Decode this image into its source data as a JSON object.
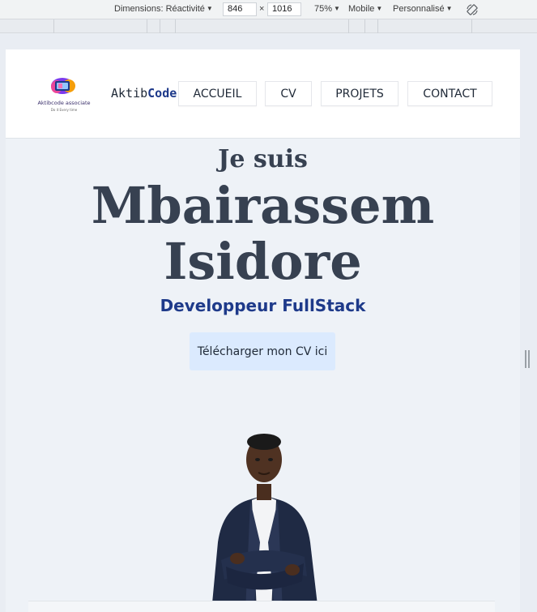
{
  "devtools": {
    "dimensions_label": "Dimensions: Réactivité",
    "width_value": "846",
    "times": "×",
    "height_value": "1016",
    "zoom": "75%",
    "device_mode": "Mobile",
    "throttle": "Personnalisé",
    "rotate_icon": "rotate-icon",
    "caret": "▼"
  },
  "site": {
    "logo_icon": "brand-logo",
    "logo_text": "Aktibcode associate",
    "logo_tagline": "Do it Every time",
    "brand_plain": "Aktib",
    "brand_bold": "Code",
    "nav": [
      "ACCUEIL",
      "CV",
      "PROJETS",
      "CONTACT"
    ],
    "hero": {
      "intro": "Je suis",
      "first_name": "Mbairassem",
      "last_name": "Isidore",
      "role": "Developpeur FullStack",
      "cv_button": "Télécharger mon CV ici"
    },
    "portrait_icon": "profile-photo"
  },
  "colors": {
    "accent": "#1e3a8a",
    "heading": "#374151",
    "button_bg": "#dbeafe"
  }
}
